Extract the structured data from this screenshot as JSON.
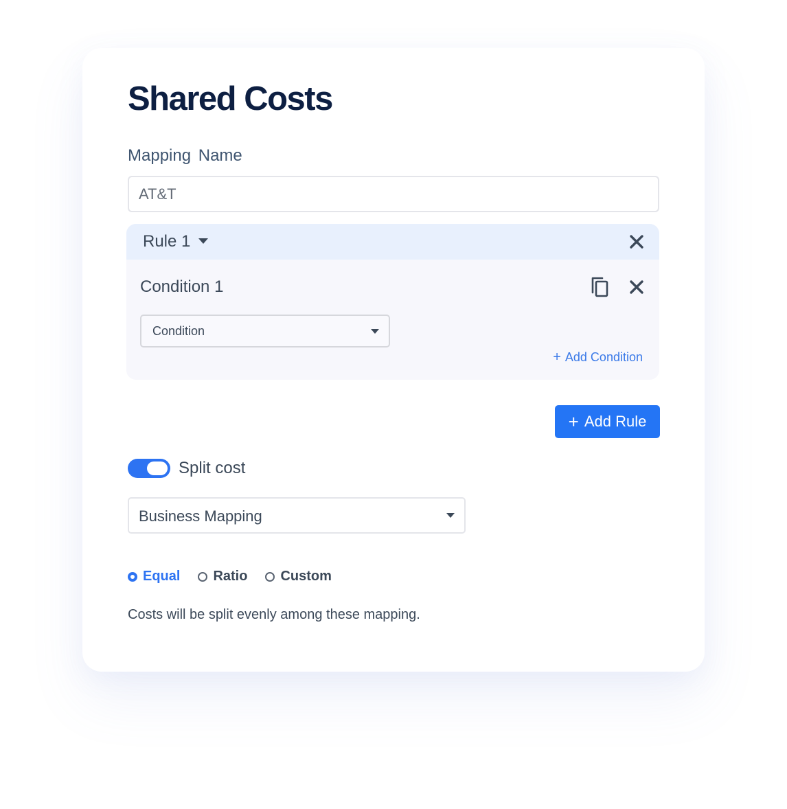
{
  "page": {
    "title": "Shared Costs",
    "mapping_name_label": "Mapping  Name",
    "mapping_name_value": "AT&T"
  },
  "rule": {
    "title": "Rule 1",
    "condition_title": "Condition 1",
    "condition_select_value": "Condition",
    "add_condition_label": "Add Condition",
    "add_condition_icon": "plus-icon"
  },
  "actions": {
    "add_rule_label": "Add Rule",
    "add_rule_icon": "plus-icon"
  },
  "split": {
    "toggle_label": "Split cost",
    "toggle_on": true,
    "mapping_select_value": "Business Mapping",
    "options": [
      {
        "label": "Equal",
        "selected": true
      },
      {
        "label": "Ratio",
        "selected": false
      },
      {
        "label": "Custom",
        "selected": false
      }
    ],
    "description": "Costs will be split evenly among these mapping."
  },
  "colors": {
    "accent": "#2475f5",
    "title": "#0d1f42",
    "rule_header_bg": "#e8f0fd",
    "rule_body_bg": "#f7f7fc"
  }
}
